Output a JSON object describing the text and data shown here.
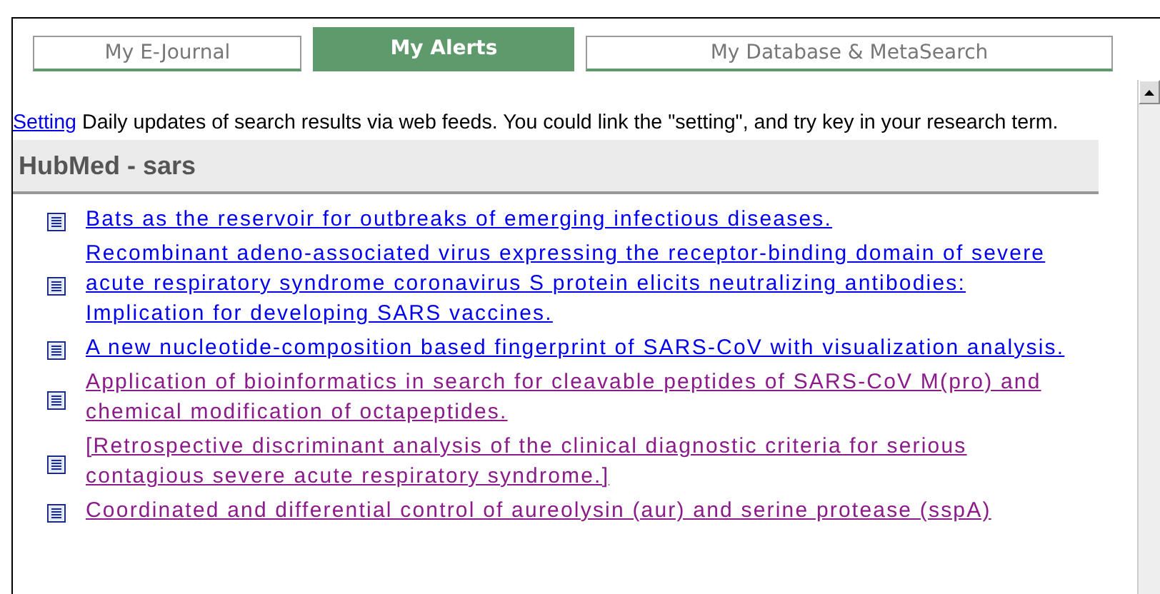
{
  "tabs": [
    {
      "label": "My E-Journal",
      "selected": false
    },
    {
      "label": "My Alerts",
      "selected": true
    },
    {
      "label": "My Database & MetaSearch",
      "selected": false
    }
  ],
  "intro": {
    "link": "Setting",
    "text": "Daily updates of search results via web feeds. You could link the \"setting\", and try key in your research term."
  },
  "feed": {
    "title": "HubMed - sars",
    "items": [
      {
        "title": "Bats as the reservoir for outbreaks of emerging infectious diseases.",
        "visited": false
      },
      {
        "title": "Recombinant adeno-associated virus expressing the receptor-binding domain of severe acute respiratory syndrome coronavirus S protein elicits neutralizing antibodies: Implication for developing SARS vaccines.",
        "visited": false
      },
      {
        "title": "A new nucleotide-composition based fingerprint of SARS-CoV with visualization analysis.",
        "visited": false
      },
      {
        "title": "Application of bioinformatics in search for cleavable peptides of SARS-CoV M(pro) and chemical modification of octapeptides.",
        "visited": true
      },
      {
        "title": "[Retrospective discriminant analysis of the clinical diagnostic criteria for serious contagious severe acute respiratory syndrome.]",
        "visited": true
      },
      {
        "title": "Coordinated and differential control of aureolysin (aur) and serine protease (sspA)",
        "visited": true
      }
    ]
  }
}
